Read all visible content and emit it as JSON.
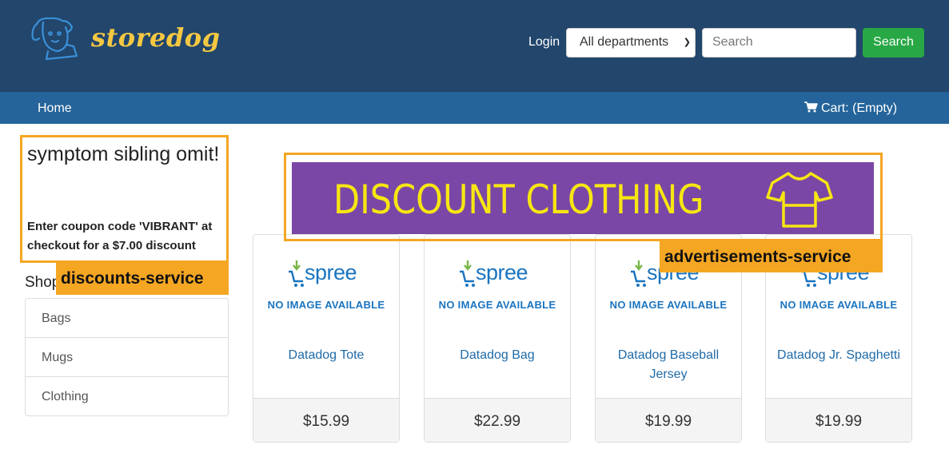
{
  "brand": {
    "name": "storedog",
    "logo_icon": "dog-icon"
  },
  "header": {
    "login_label": "Login",
    "department_selected": "All departments",
    "search_placeholder": "Search",
    "search_button": "Search"
  },
  "nav": {
    "home": "Home",
    "cart": "Cart: (Empty)",
    "cart_icon": "shopping-cart-icon"
  },
  "discount": {
    "title": "symptom sibling omit!",
    "description": "Enter coupon code 'VIBRANT' at checkout for a $7.00 discount",
    "service_tag": "discounts-service"
  },
  "shop": {
    "heading": "Shop",
    "taxons": [
      {
        "label": "Bags"
      },
      {
        "label": "Mugs"
      },
      {
        "label": "Clothing"
      }
    ]
  },
  "ad": {
    "text": "DISCOUNT CLOTHING",
    "icon": "t-shirt-icon",
    "service_tag": "advertisements-service",
    "colors": {
      "background": "#7a47a6",
      "text": "#f7e612",
      "tag": "#f5a623"
    }
  },
  "products": [
    {
      "logo": "spree",
      "no_image": "NO IMAGE AVAILABLE",
      "name": "Datadog Tote",
      "price": "$15.99"
    },
    {
      "logo": "spree",
      "no_image": "NO IMAGE AVAILABLE",
      "name": "Datadog Bag",
      "price": "$22.99"
    },
    {
      "logo": "spree",
      "no_image": "NO IMAGE AVAILABLE",
      "name": "Datadog Baseball Jersey",
      "price": "$19.99"
    },
    {
      "logo": "spree",
      "no_image": "NO IMAGE AVAILABLE",
      "name": "Datadog Jr. Spaghetti",
      "price": "$19.99"
    }
  ],
  "colors": {
    "header_bg": "#22466c",
    "nav_bg": "#24649a",
    "search_button_bg": "#28a745",
    "brand_text": "#f5c842"
  }
}
